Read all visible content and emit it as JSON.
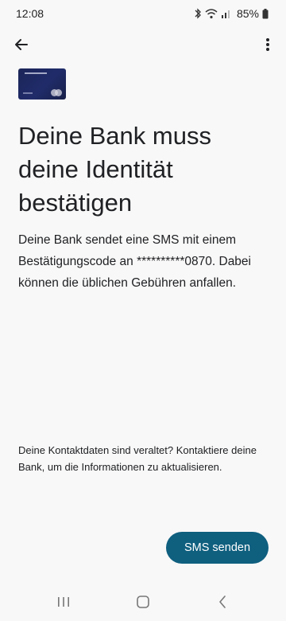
{
  "status_bar": {
    "time": "12:08",
    "battery_percent": "85%",
    "icons": [
      "bluetooth-icon",
      "wifi-icon",
      "signal-icon",
      "battery-icon"
    ]
  },
  "app_bar": {
    "back_icon": "arrow-back-icon",
    "menu_icon": "more-vert-icon"
  },
  "content": {
    "title": "Deine Bank muss deine Identität bestätigen",
    "body": "Deine Bank sendet eine SMS mit einem Bestätigungscode an **********0870. Dabei können die üblichen Gebühren anfallen.",
    "footer_note": "Deine Kontaktdaten sind veraltet? Kontaktiere deine Bank, um die Informationen zu aktualisieren.",
    "primary_button": "SMS senden"
  },
  "colors": {
    "background": "#f8f8f8",
    "primary": "#0f5f7f",
    "card": "#1b2558",
    "text": "#202124"
  },
  "nav_bar": {
    "icons": [
      "recents-icon",
      "home-icon",
      "back-nav-icon"
    ]
  }
}
